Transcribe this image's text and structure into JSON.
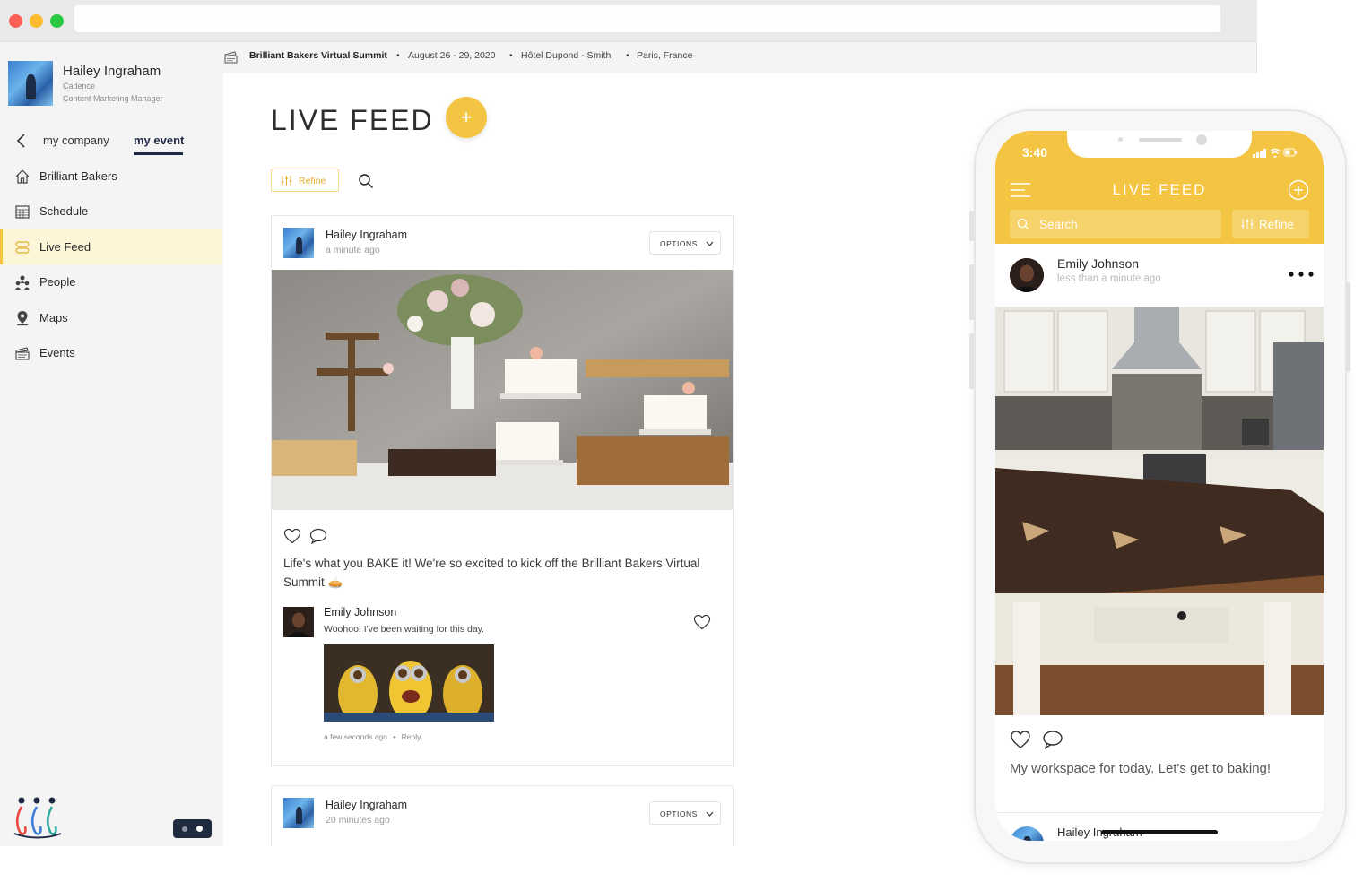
{
  "user": {
    "name": "Hailey Ingraham",
    "company": "Cadence",
    "role": "Content Marketing Manager"
  },
  "sidebar": {
    "tabs": {
      "company": "my company",
      "event": "my event"
    },
    "items": [
      {
        "label": "Brilliant Bakers",
        "icon": "home-icon"
      },
      {
        "label": "Schedule",
        "icon": "calendar-icon"
      },
      {
        "label": "Live Feed",
        "icon": "feed-icon"
      },
      {
        "label": "People",
        "icon": "people-icon"
      },
      {
        "label": "Maps",
        "icon": "map-pin-icon"
      },
      {
        "label": "Events",
        "icon": "ticket-icon"
      }
    ]
  },
  "event": {
    "name": "Brilliant Bakers Virtual Summit",
    "dates": "August 26 - 29, 2020",
    "venue": "Hôtel Dupond - Smith",
    "location": "Paris, France",
    "separator": "•"
  },
  "feed": {
    "title": "LIVE FEED",
    "add_label": "+",
    "refine_label": "Refine",
    "options_label": "OPTIONS",
    "posts": [
      {
        "author": "Hailey Ingraham",
        "time": "a minute ago",
        "caption": "Life's what you BAKE it! We're so excited to kick off the Brilliant Bakers Virtual Summit 🥧",
        "comment": {
          "author": "Emily Johnson",
          "text": "Woohoo! I've been waiting for this day.",
          "meta": "a few seconds ago",
          "reply": "Reply"
        }
      },
      {
        "author": "Hailey Ingraham",
        "time": "20 minutes ago"
      }
    ]
  },
  "mobile": {
    "time": "3:40",
    "title": "LIVE FEED",
    "search_placeholder": "Search",
    "refine_label": "Refine",
    "post": {
      "author": "Emily Johnson",
      "time": "less than a minute ago",
      "caption": "My workspace for today. Let's get to baking!"
    },
    "next_author": "Hailey Ingraham"
  },
  "colors": {
    "accent": "#f4c542",
    "active_bg": "#fdf5d8",
    "navy": "#1f2b44"
  }
}
